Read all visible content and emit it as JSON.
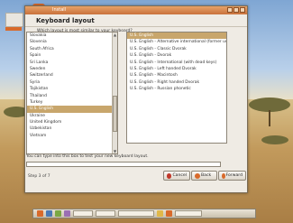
{
  "window": {
    "title": "Install",
    "heading": "Keyboard layout",
    "question": "Which layout is most similar to your keyboard?"
  },
  "layouts": [
    "Slovakia",
    "Slovenia",
    "South Africa",
    "Spain",
    "Sri Lanka",
    "Sweden",
    "Switzerland",
    "Syria",
    "Tajikistan",
    "Thailand",
    "Turkey",
    "U.S. English",
    "Ukraine",
    "United Kingdom",
    "Uzbekistan",
    "Vietnam"
  ],
  "selected_layout": "U.S. English",
  "variants": [
    "U.S. English",
    "U.S. English - Alternative international (former us_intl)",
    "U.S. English - Classic Dvorak",
    "U.S. English - Dvorak",
    "U.S. English - International (with dead keys)",
    "U.S. English - Left handed Dvorak",
    "U.S. English - Macintosh",
    "U.S. English - Right handed Dvorak",
    "U.S. English - Russian phonetic"
  ],
  "selected_variant": "U.S. English",
  "test": {
    "hint": "You can type into this box to test your new keyboard layout.",
    "value": ""
  },
  "footer": {
    "step": "Step 3 of 7",
    "cancel": "Cancel",
    "back": "Back",
    "forward": "Forward"
  },
  "colors": {
    "accent": "#d86a2b",
    "selection": "#c8a66c"
  }
}
